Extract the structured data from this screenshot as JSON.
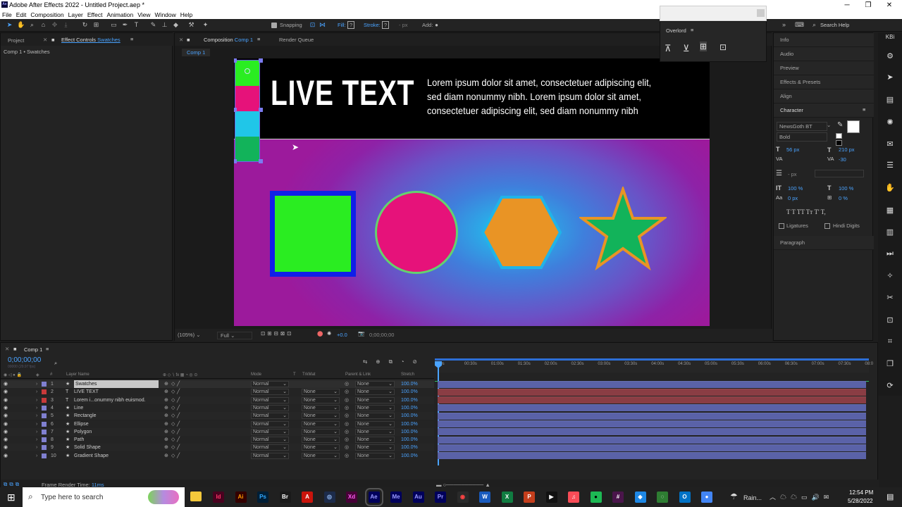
{
  "app": {
    "title": "Adobe After Effects 2022 - Untitled Project.aep *"
  },
  "menu": [
    "File",
    "Edit",
    "Composition",
    "Layer",
    "Effect",
    "Animation",
    "View",
    "Window",
    "Help"
  ],
  "toolbar": {
    "snapping": "Snapping",
    "fill": "Fill:",
    "fill_val": "?",
    "stroke": "Stroke:",
    "stroke_val": "?",
    "px": "- px",
    "add": "Add:",
    "search": "Search Help"
  },
  "left_panel": {
    "tab_project": "Project",
    "tab_effect": "Effect Controls",
    "tab_effect_layer": "Swatches",
    "breadcrumb": "Comp 1 • Swatches"
  },
  "comp_panel": {
    "tab": "Composition",
    "tab_name": "Comp 1",
    "render_queue": "Render Queue",
    "subtab": "Comp 1",
    "zoom": "(105%)",
    "resolution": "Full",
    "exposure": "+0.0",
    "timecode": "0;00;00;00"
  },
  "composition": {
    "live_text": "LIVE TEXT",
    "lorem": [
      "Lorem ipsum dolor sit amet, consectetuer adipiscing elit,",
      "sed diam nonummy nibh. Lorem ipsum dolor sit amet,",
      "consectetuer adipiscing elit, sed diam nonummy nibh"
    ],
    "colors": {
      "green": "#2aed21",
      "magenta": "#e6127a",
      "cyan": "#20c6e8",
      "dark_green": "#12b35a",
      "orange": "#e99425",
      "blue_stroke": "#1020e8"
    }
  },
  "overlord": {
    "title": "Overlord"
  },
  "right_panel": {
    "sections": [
      "Info",
      "Audio",
      "Preview",
      "Effects & Presets",
      "Align"
    ],
    "character": {
      "title": "Character",
      "font": "NewsGoth BT",
      "style": "Bold",
      "size": "56 px",
      "tracking": "210 px",
      "kerning": "-30",
      "leading": "- px",
      "vscale": "100 %",
      "hscale": "100 %",
      "baseline": "0 px",
      "tsume": "0 %",
      "ligatures": "Ligatures",
      "hindi": "Hindi Digits",
      "t_btns": "T  T  TT  Tт  T'  T,"
    },
    "paragraph": "Paragraph"
  },
  "timeline": {
    "tab": "Comp 1",
    "timecode": "0;00;00;00",
    "timecode_sub": "00000 (29.97 fps)",
    "headers": {
      "layer_name": "Layer Name",
      "mode": "Mode",
      "t": "T",
      "trkmat": "TrkMat",
      "parent": "Parent & Link",
      "stretch": "Stretch"
    },
    "ruler": [
      "00s",
      "00:30s",
      "01:00s",
      "01:30s",
      "02:00s",
      "02:30s",
      "03:00s",
      "03:30s",
      "04:00s",
      "04:30s",
      "05:00s",
      "05:30s",
      "06:00s",
      "06:30s",
      "07:00s",
      "07:30s",
      "08:0"
    ],
    "layers": [
      {
        "num": "1",
        "type": "★",
        "name": "Swatches",
        "mode": "Normal",
        "trkmat": "",
        "parent": "None",
        "stretch": "100.0%",
        "label": "#8080d0",
        "bar": "#5a62a8"
      },
      {
        "num": "2",
        "type": "T",
        "name": "LIVE TEXT",
        "mode": "Normal",
        "trkmat": "None",
        "parent": "None",
        "stretch": "100.0%",
        "label": "#c83a3a",
        "bar": "#8a3d44"
      },
      {
        "num": "3",
        "type": "T",
        "name": "Lorem i...onummy nibh euismod.",
        "mode": "Normal",
        "trkmat": "None",
        "parent": "None",
        "stretch": "100.0%",
        "label": "#c83a3a",
        "bar": "#8a3d44"
      },
      {
        "num": "4",
        "type": "★",
        "name": "Line",
        "mode": "Normal",
        "trkmat": "None",
        "parent": "None",
        "stretch": "100.0%",
        "label": "#8080d0",
        "bar": "#5a62a8"
      },
      {
        "num": "5",
        "type": "★",
        "name": "Rectangle",
        "mode": "Normal",
        "trkmat": "None",
        "parent": "None",
        "stretch": "100.0%",
        "label": "#8080d0",
        "bar": "#5a62a8"
      },
      {
        "num": "6",
        "type": "★",
        "name": "Ellipse",
        "mode": "Normal",
        "trkmat": "None",
        "parent": "None",
        "stretch": "100.0%",
        "label": "#8080d0",
        "bar": "#5a62a8"
      },
      {
        "num": "7",
        "type": "★",
        "name": "Polygon",
        "mode": "Normal",
        "trkmat": "None",
        "parent": "None",
        "stretch": "100.0%",
        "label": "#8080d0",
        "bar": "#5a62a8"
      },
      {
        "num": "8",
        "type": "★",
        "name": "Path",
        "mode": "Normal",
        "trkmat": "None",
        "parent": "None",
        "stretch": "100.0%",
        "label": "#8080d0",
        "bar": "#5a62a8"
      },
      {
        "num": "9",
        "type": "★",
        "name": "Solid Shape",
        "mode": "Normal",
        "trkmat": "None",
        "parent": "None",
        "stretch": "100.0%",
        "label": "#8080d0",
        "bar": "#5a62a8"
      },
      {
        "num": "10",
        "type": "★",
        "name": "Gradient Shape",
        "mode": "Normal",
        "trkmat": "None",
        "parent": "None",
        "stretch": "100.0%",
        "label": "#8080d0",
        "bar": "#5a62a8"
      }
    ],
    "footer": {
      "label": "Frame Render Time:",
      "value": "11ms"
    }
  },
  "taskbar": {
    "search": "Type here to search",
    "weather": "Rain...",
    "time": "12:54 PM",
    "date": "5/28/2022",
    "apps": [
      {
        "name": "Id",
        "color": "#49021f",
        "fg": "#ff3366"
      },
      {
        "name": "Ai",
        "color": "#330000",
        "fg": "#ff9a00"
      },
      {
        "name": "Ps",
        "color": "#001e36",
        "fg": "#31a8ff"
      },
      {
        "name": "Br",
        "color": "#1a1a1a",
        "fg": "#ffffff"
      },
      {
        "name": "A",
        "color": "#c9140c",
        "fg": "#ffffff"
      },
      {
        "name": "◎",
        "color": "#1c2b4a",
        "fg": "#9cc4ff"
      },
      {
        "name": "Xd",
        "color": "#470137",
        "fg": "#ff61f6"
      },
      {
        "name": "Ae",
        "color": "#00005b",
        "fg": "#9999ff"
      },
      {
        "name": "Me",
        "color": "#00005b",
        "fg": "#9999ff"
      },
      {
        "name": "Au",
        "color": "#00005b",
        "fg": "#9999ff"
      },
      {
        "name": "Pr",
        "color": "#00005b",
        "fg": "#9999ff"
      },
      {
        "name": "◉",
        "color": "#2a2a2a",
        "fg": "#ff4444"
      },
      {
        "name": "W",
        "color": "#185abd",
        "fg": "#ffffff"
      },
      {
        "name": "X",
        "color": "#107c41",
        "fg": "#ffffff"
      },
      {
        "name": "P",
        "color": "#c43e1c",
        "fg": "#ffffff"
      },
      {
        "name": "▶",
        "color": "#111111",
        "fg": "#ffffff"
      },
      {
        "name": "♫",
        "color": "#f94c57",
        "fg": "#ffffff"
      },
      {
        "name": "●",
        "color": "#1db954",
        "fg": "#000000"
      },
      {
        "name": "#",
        "color": "#4a154b",
        "fg": "#ffffff"
      },
      {
        "name": "◆",
        "color": "#1e88e5",
        "fg": "#ffffff"
      },
      {
        "name": "◌",
        "color": "#2e7d32",
        "fg": "#ffffff"
      },
      {
        "name": "O",
        "color": "#0072c6",
        "fg": "#ffffff"
      },
      {
        "name": "●",
        "color": "#4285f4",
        "fg": "#ffffff"
      }
    ]
  }
}
